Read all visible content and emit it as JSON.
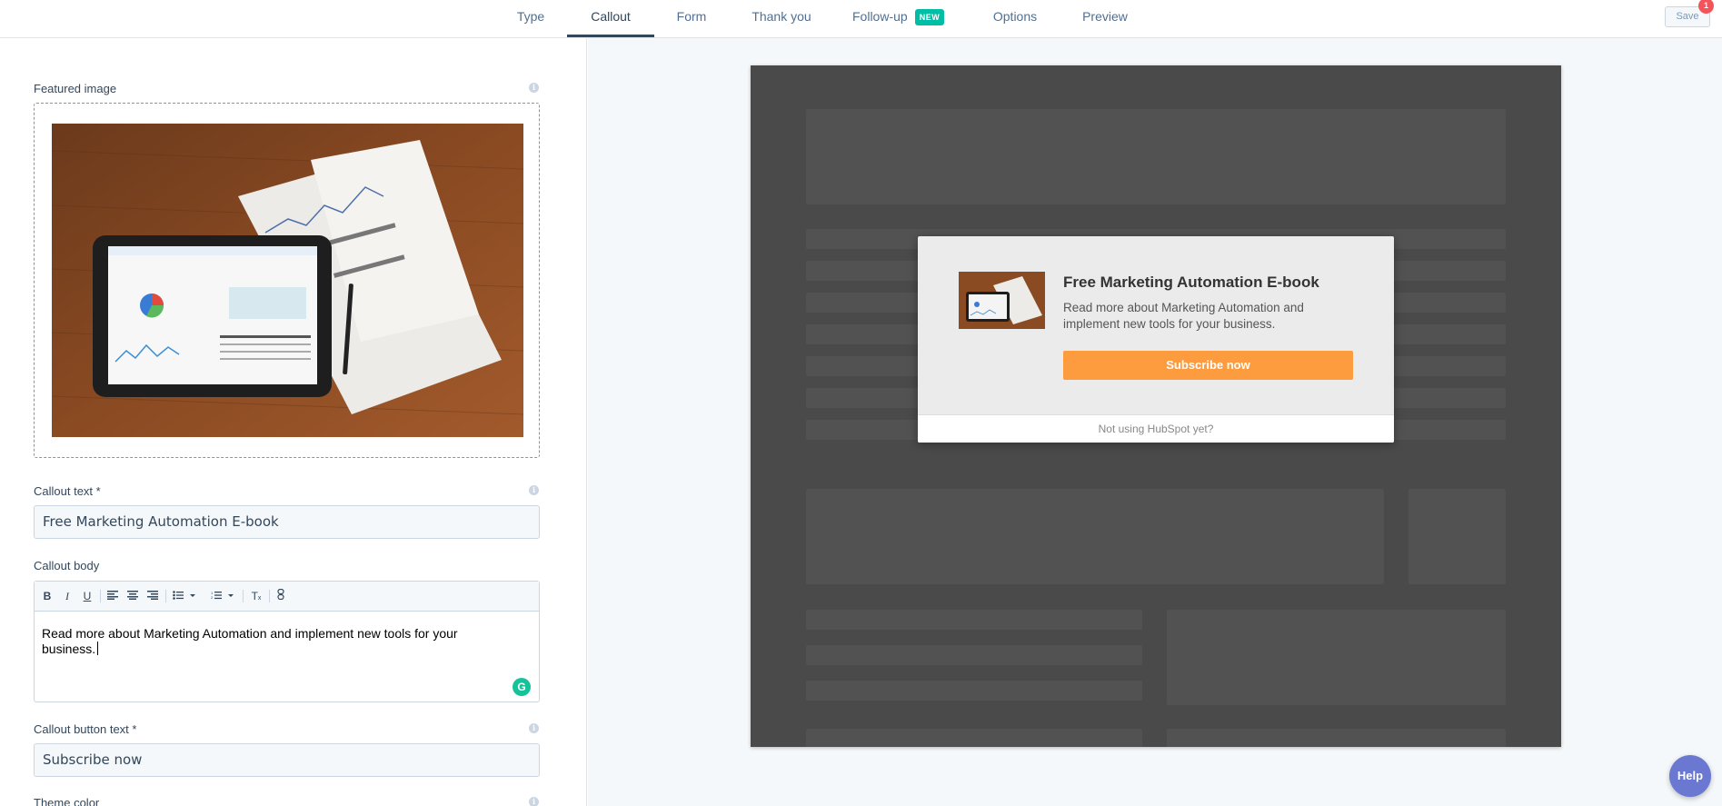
{
  "nav": {
    "tabs": [
      {
        "label": "Type"
      },
      {
        "label": "Callout"
      },
      {
        "label": "Form"
      },
      {
        "label": "Thank you"
      },
      {
        "label": "Follow-up",
        "badge": "NEW"
      },
      {
        "label": "Options"
      },
      {
        "label": "Preview"
      }
    ],
    "active_tab": "Callout",
    "save_label": "Save",
    "notification_count": "1"
  },
  "editor_panel": {
    "featured_image_label": "Featured image",
    "callout_text_label": "Callout text *",
    "callout_text_value": "Free Marketing Automation E-book",
    "callout_body_label": "Callout body",
    "callout_body_value": "Read more about Marketing Automation and implement new tools for your business.",
    "callout_button_label": "Callout button text *",
    "callout_button_value": "Subscribe now",
    "theme_color_label": "Theme color",
    "toolbar": [
      "bold-icon",
      "italic-icon",
      "underline-icon",
      "align-left-icon",
      "align-center-icon",
      "align-right-icon",
      "bulleted-list-icon",
      "numbered-list-icon",
      "clear-format-icon",
      "link-icon"
    ]
  },
  "preview": {
    "callout_title": "Free Marketing Automation E-book",
    "callout_body": "Read more about Marketing Automation and implement new tools for your business.",
    "callout_button": "Subscribe now",
    "footer_link": "Not using HubSpot yet?"
  },
  "help_label": "Help",
  "colors": {
    "accent_teal": "#00bda5",
    "callout_button": "#fd9b3f",
    "preview_bg": "#4a4a4a",
    "help_button": "#6a78d1"
  }
}
